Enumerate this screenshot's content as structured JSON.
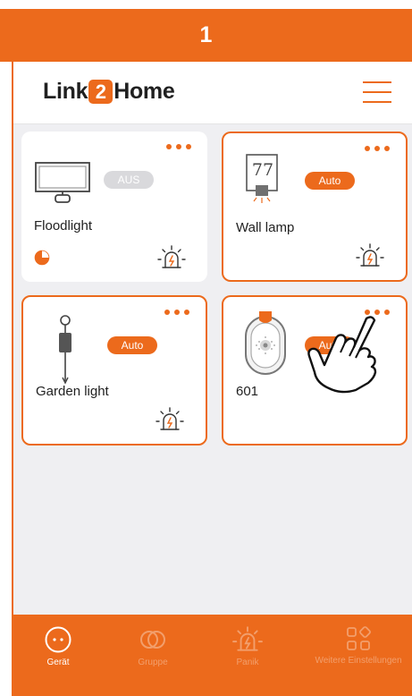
{
  "step": {
    "number": "1"
  },
  "app": {
    "logo_left": "Link",
    "logo_mid": "2",
    "logo_right": "Home"
  },
  "devices": [
    {
      "name": "Floodlight",
      "status": "AUS"
    },
    {
      "name": "Wall lamp",
      "status": "Auto",
      "display": "77"
    },
    {
      "name": "Garden light",
      "status": "Auto"
    },
    {
      "name": "601",
      "status": "Auto"
    }
  ],
  "tabs": [
    {
      "label": "Gerät",
      "icon": "device-icon"
    },
    {
      "label": "Gruppe",
      "icon": "group-icon"
    },
    {
      "label": "Panik",
      "icon": "panic-icon"
    },
    {
      "label": "Weitere Einstellungen",
      "icon": "settings-grid-icon"
    }
  ],
  "colors": {
    "accent": "#ec6a1c",
    "background": "#efeff2",
    "card": "#ffffff",
    "badge_off": "#d9d9dc"
  }
}
